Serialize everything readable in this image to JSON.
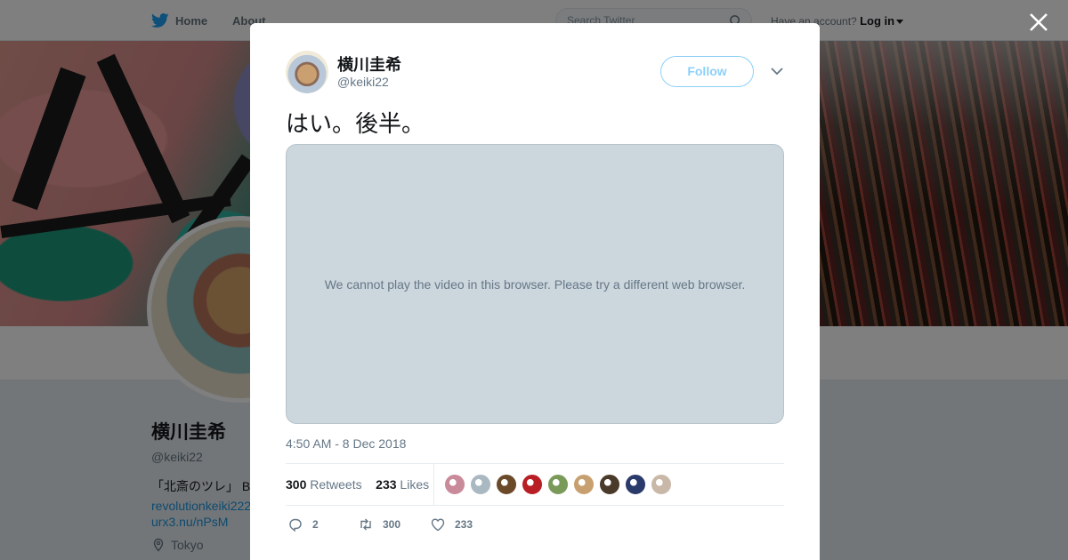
{
  "nav": {
    "home_label": "Home",
    "about_label": "About",
    "search_placeholder": "Search Twitter",
    "account_prompt": "Have an account?",
    "login_label": "Log in"
  },
  "profile": {
    "name": "横川圭希",
    "handle": "@keiki22",
    "bio_line": "「北斎のツレ」 B",
    "link_1": "revolutionkeiki222",
    "link_2": "urx3.nu/nPsM",
    "location": "Tokyo"
  },
  "tweet": {
    "author_name": "横川圭希",
    "author_handle": "@keiki22",
    "follow_label": "Follow",
    "text": "はい。後半。",
    "video_message": "We cannot play the video in this browser. Please try a different web browser.",
    "timestamp": "4:50 AM - 8 Dec 2018",
    "retweet_count": "300",
    "retweet_label": "Retweets",
    "like_count": "233",
    "like_label": "Likes",
    "reply_action_count": "2",
    "retweet_action_count": "300",
    "like_action_count": "233"
  },
  "liker_colors": [
    "#c98a9a",
    "#aab8c2",
    "#6b4a2a",
    "#b81e24",
    "#7a9a5a",
    "#c8a070",
    "#4a3a2a",
    "#2a3a6a",
    "#c9b8a8"
  ],
  "colors": {
    "accent": "#1da1f2",
    "muted": "#657786",
    "video_bg": "#ccd6dd"
  }
}
